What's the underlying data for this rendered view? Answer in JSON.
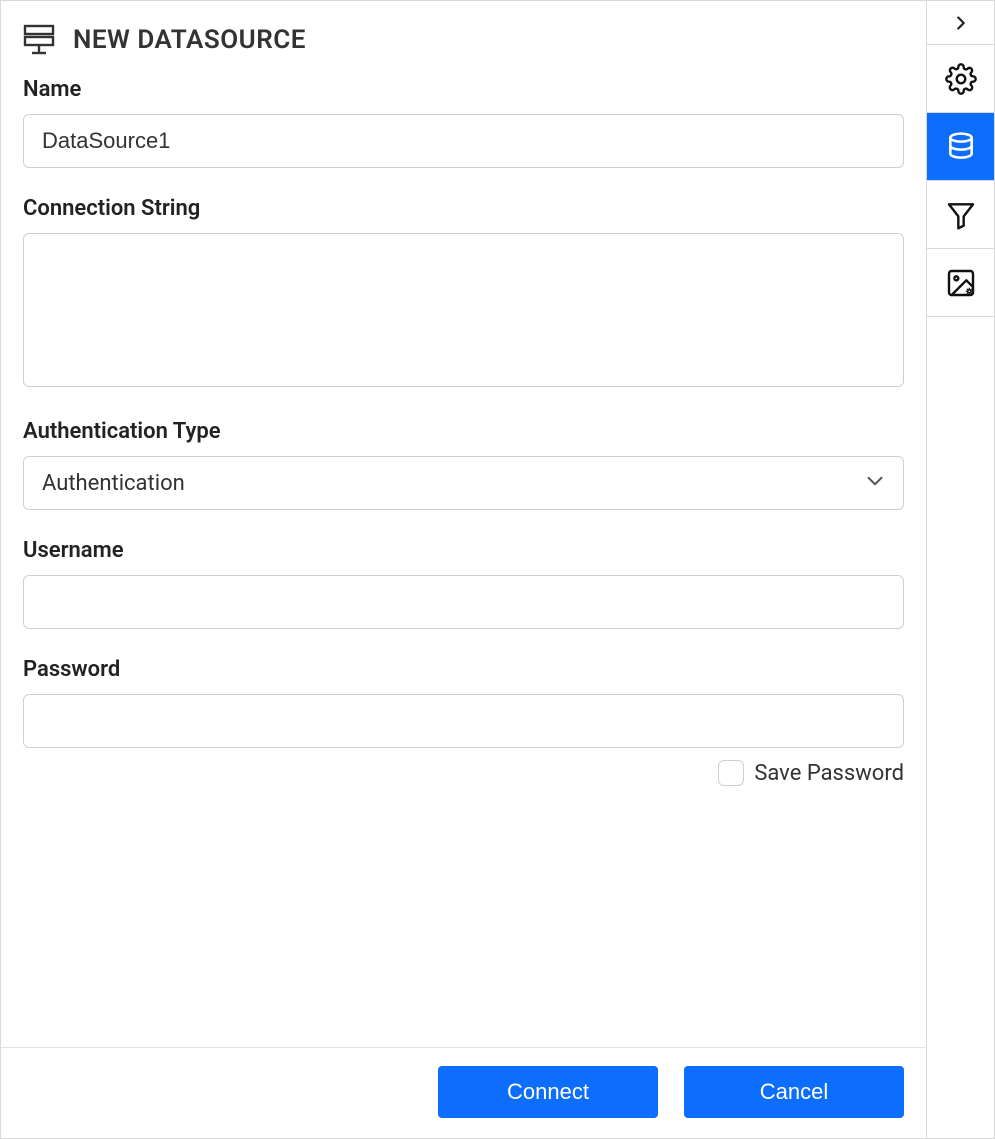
{
  "header": {
    "title": "NEW DATASOURCE"
  },
  "fields": {
    "name_label": "Name",
    "name_value": "DataSource1",
    "connstr_label": "Connection String",
    "connstr_value": "",
    "authtype_label": "Authentication Type",
    "authtype_selected": "Authentication",
    "username_label": "Username",
    "username_value": "",
    "password_label": "Password",
    "password_value": "",
    "save_password_label": "Save Password",
    "save_password_checked": false
  },
  "footer": {
    "connect_label": "Connect",
    "cancel_label": "Cancel"
  },
  "rail": {
    "items": [
      {
        "name": "expand",
        "active": false
      },
      {
        "name": "settings",
        "active": false
      },
      {
        "name": "datasource",
        "active": true
      },
      {
        "name": "filter",
        "active": false
      },
      {
        "name": "image-settings",
        "active": false
      }
    ]
  },
  "colors": {
    "accent": "#0d6efd",
    "border": "#cfcfcf",
    "text": "#222222"
  }
}
